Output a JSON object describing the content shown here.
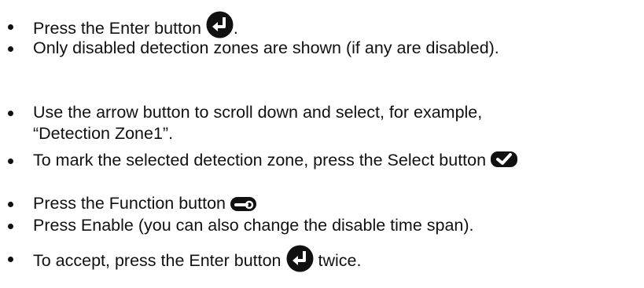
{
  "steps": [
    {
      "text_before": "Press the Enter button",
      "icon": "enter-icon",
      "text_after": "."
    },
    {
      "text": "Only disabled detection zones are shown (if any are disabled)."
    },
    {
      "line1": "Use the arrow button to scroll down and select, for example,",
      "line2": "“Detection Zone1”."
    },
    {
      "text_before": "To mark the selected detection zone, press the Select button",
      "icon": "select-icon",
      "text_after": ""
    },
    {
      "text_before": "Press the Function button",
      "icon": "function-icon",
      "text_after": ""
    },
    {
      "text": "Press Enable (you can also change the disable time span)."
    },
    {
      "text_before": "To accept, press the Enter button",
      "icon": "enter-icon",
      "text_after": "twice."
    }
  ]
}
